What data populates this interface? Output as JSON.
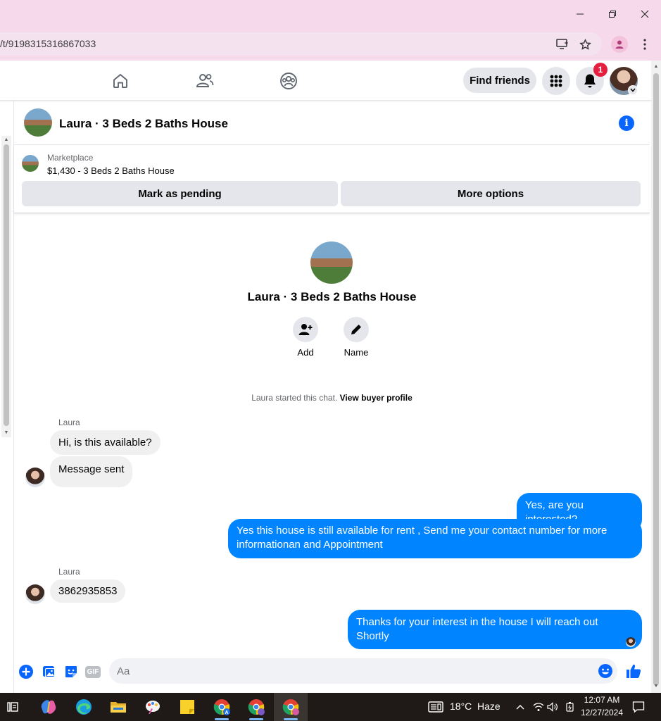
{
  "browser": {
    "url": "/t/9198315316867033",
    "window_controls": [
      "minimize-icon",
      "restore-icon",
      "close-icon"
    ]
  },
  "nav": {
    "find_friends_label": "Find friends",
    "notification_count": "1"
  },
  "chat": {
    "title": "Laura · 3 Beds 2 Baths House",
    "marketplace_label": "Marketplace",
    "listing": "$1,430 - 3 Beds 2 Baths House",
    "mark_pending_label": "Mark as pending",
    "more_options_label": "More options",
    "intro_title": "Laura · 3 Beds 2 Baths House",
    "add_label": "Add",
    "name_label": "Name",
    "started_text": "Laura started this chat.",
    "view_buyer_label": "View buyer profile"
  },
  "messages": [
    {
      "sender": "Laura",
      "text": "Hi, is this available?"
    },
    {
      "text": "Message sent"
    },
    {
      "text": "Yes, are you interested?"
    },
    {
      "text": "Yes this house is still available for rent , Send me your contact number for more informationan and Appointment"
    },
    {
      "sender": "Laura",
      "text": "3862935853"
    },
    {
      "text": "Thanks for your interest in the house I will reach out Shortly"
    }
  ],
  "composer": {
    "placeholder": "Aa",
    "gif_label": "GIF"
  },
  "taskbar": {
    "temperature": "18°C",
    "weather": "Haze",
    "time": "12:07 AM",
    "date": "12/27/2024"
  },
  "colors": {
    "accent_blue": "#0866ff",
    "outgoing_bubble": "#0084ff",
    "incoming_bubble": "#f0f0f0",
    "titlebar_pink": "#f7d9ec",
    "badge_red": "#e41e3f"
  }
}
